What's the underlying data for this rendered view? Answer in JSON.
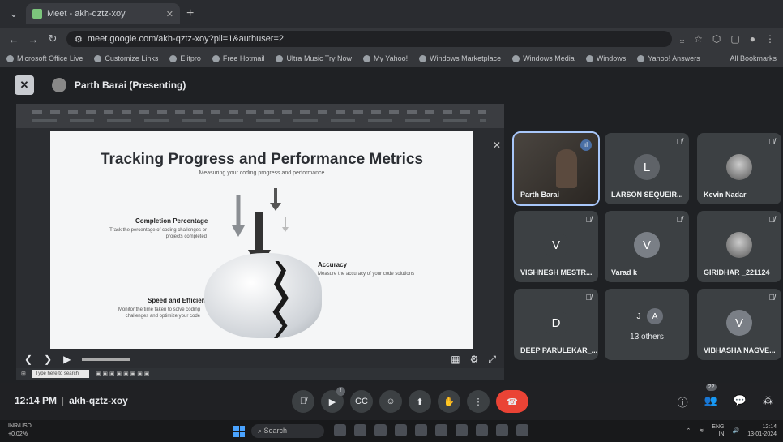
{
  "browser": {
    "tab_title": "Meet - akh-qztz-xoy",
    "url": "meet.google.com/akh-qztz-xoy?pli=1&authuser=2",
    "bookmarks": [
      "Microsoft Office Live",
      "Customize Links",
      "Elitpro",
      "Free Hotmail",
      "Ultra Music Try Now",
      "My Yahoo!",
      "Windows Marketplace",
      "Windows Media",
      "Windows",
      "Yahoo! Answers"
    ],
    "all_bookmarks": "All Bookmarks"
  },
  "presenting": {
    "label": "Parth Barai (Presenting)"
  },
  "slide": {
    "title": "Tracking Progress and Performance Metrics",
    "subtitle": "Measuring your coding progress and performance",
    "completion_title": "Completion Percentage",
    "completion_desc": "Track the percentage of coding challenges or projects completed",
    "accuracy_title": "Accuracy",
    "accuracy_desc": "Measure the accuracy of your code solutions",
    "speed_title": "Speed and Efficiency",
    "speed_desc": "Monitor the time taken to solve coding challenges and optimize your code"
  },
  "inner_taskbar": {
    "search": "Type here to search"
  },
  "participants": [
    {
      "name": "Parth Barai",
      "initial": "",
      "color": "",
      "type": "camera"
    },
    {
      "name": "LARSON SEQUEIR...",
      "initial": "L",
      "color": "#5f6368",
      "type": "initial"
    },
    {
      "name": "Kevin Nadar",
      "initial": "",
      "color": "",
      "type": "photo"
    },
    {
      "name": "VIGHNESH MESTR...",
      "initial": "V",
      "color": "#3c4043",
      "type": "initial"
    },
    {
      "name": "Varad k",
      "initial": "V",
      "color": "#7a7f86",
      "type": "initial"
    },
    {
      "name": "GIRIDHAR _221124",
      "initial": "",
      "color": "",
      "type": "photo"
    },
    {
      "name": "DEEP PARULEKAR_...",
      "initial": "D",
      "color": "#3c4043",
      "type": "initial"
    },
    {
      "name": "13 others",
      "initial": "J",
      "initial2": "A",
      "color": "#6b7078",
      "type": "others"
    },
    {
      "name": "VIBHASHA NAGVE...",
      "initial": "V",
      "color": "#7a7f86",
      "type": "initial"
    }
  ],
  "meeting": {
    "time": "12:14 PM",
    "code": "akh-qztz-xoy",
    "participant_count": "22"
  },
  "taskbar": {
    "ticker": "INR/USD",
    "ticker_sub": "+0.02%",
    "search": "Search",
    "lang": "ENG",
    "lang_sub": "IN",
    "clock_time": "12:14",
    "clock_date": "13-01-2024"
  },
  "colors": {
    "end_call": "#ea4335",
    "tile_bg": "#3c4043",
    "active_border": "#a8c7fa"
  }
}
